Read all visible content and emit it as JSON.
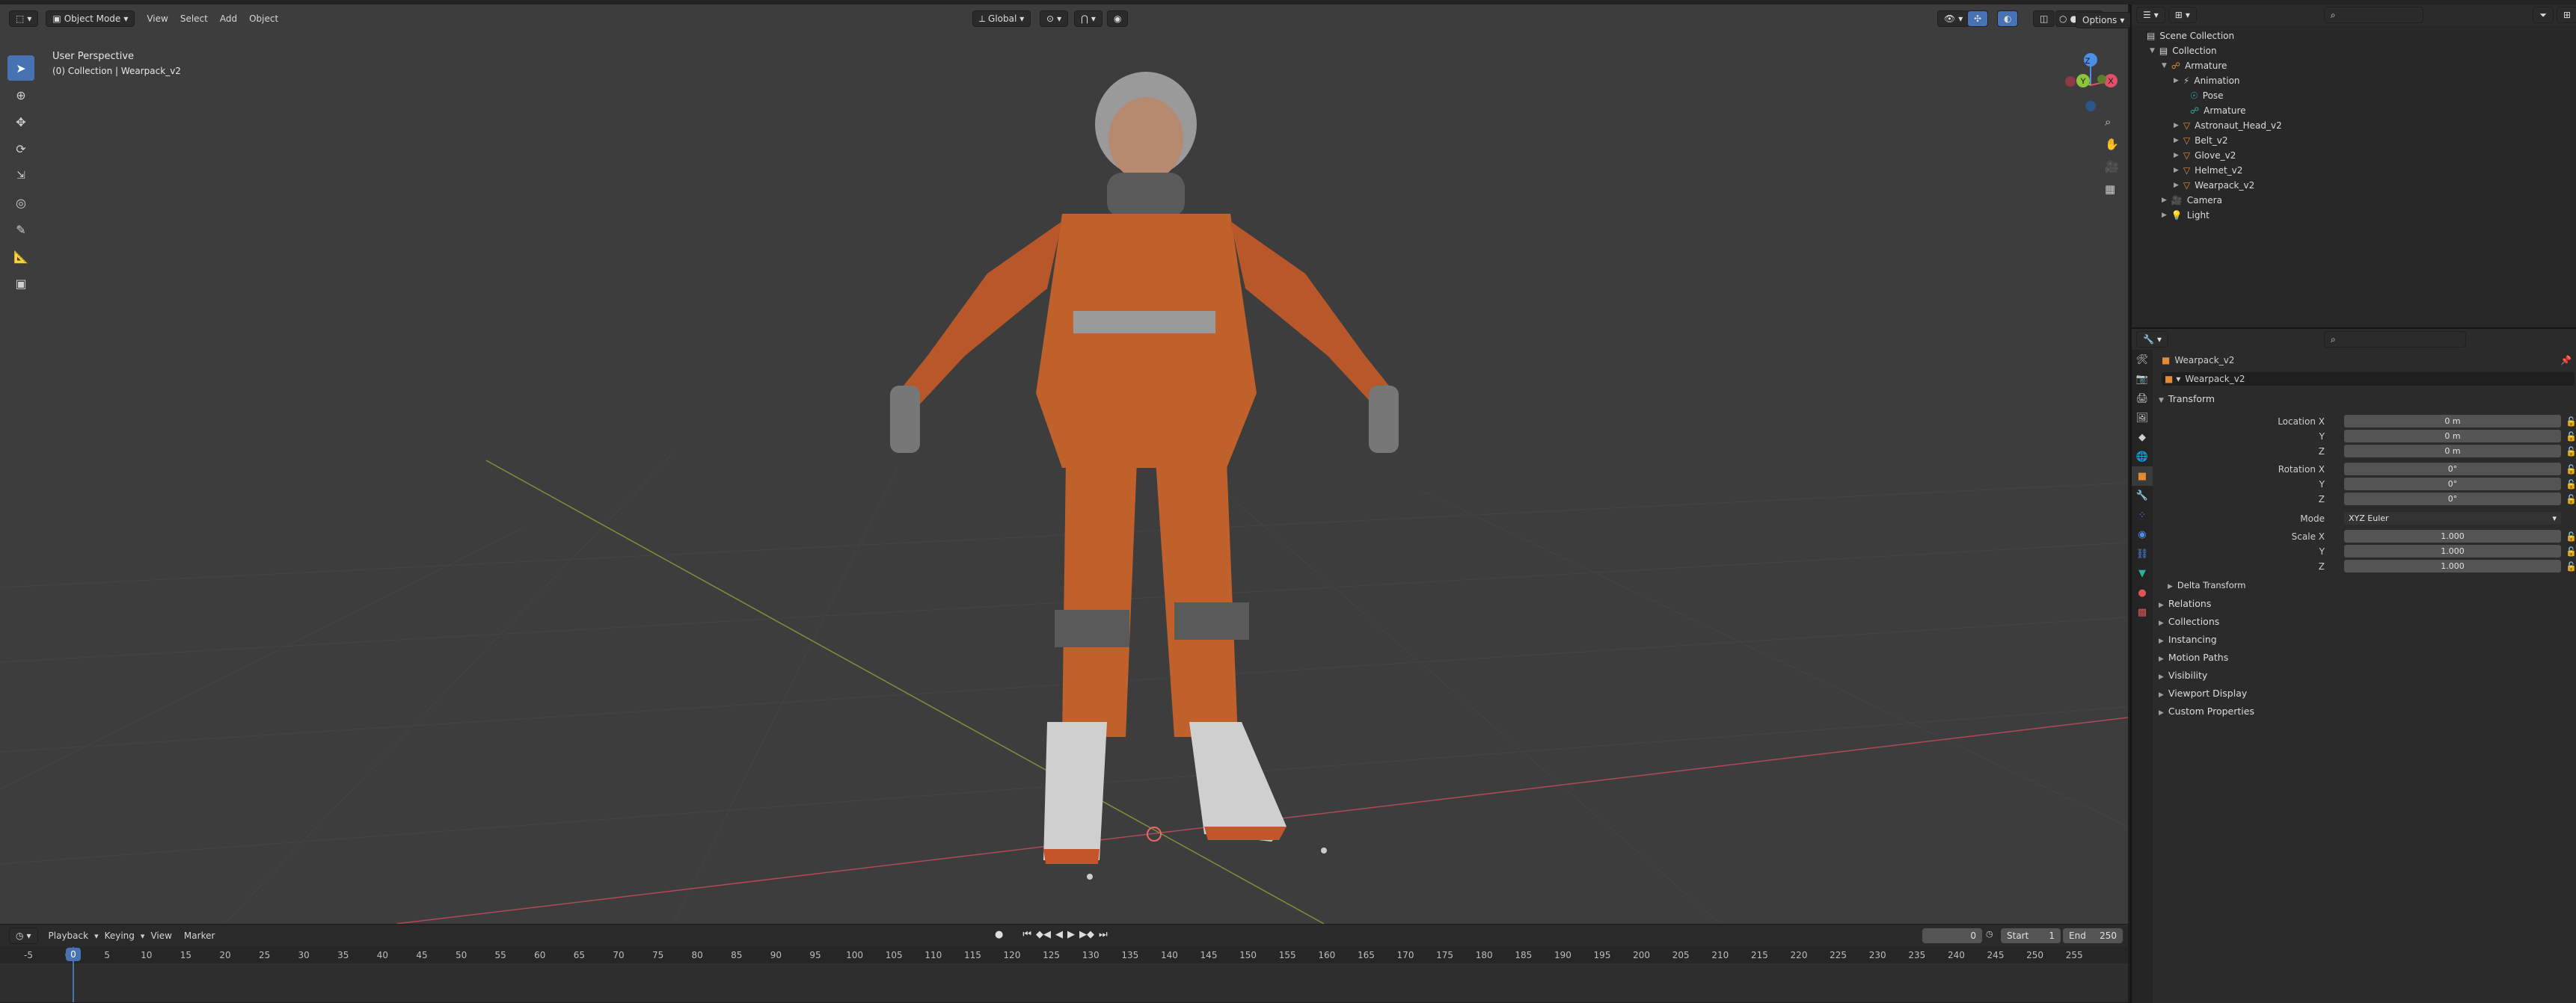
{
  "colors": {
    "accent": "#4772b3",
    "x_axis": "#e0506a",
    "y_axis": "#8cc43a",
    "z_axis": "#4d8ee8",
    "orange": "#e38a3a",
    "teal": "#28b5a0"
  },
  "viewport": {
    "mode_label": "Object Mode",
    "menu": [
      "View",
      "Select",
      "Add",
      "Object"
    ],
    "transform_orientation": "Global",
    "options_label": "Options",
    "overlay_title": "User Perspective",
    "overlay_subtitle": "(0) Collection | Wearpack_v2",
    "gizmo": {
      "x": "X",
      "y": "Y",
      "z": "Z"
    }
  },
  "timeline": {
    "menu": [
      "Playback",
      "Keying",
      "View",
      "Marker"
    ],
    "current_frame": "0",
    "start_label": "Start",
    "start_value": "1",
    "end_label": "End",
    "end_value": "250",
    "playhead": "0",
    "ruler": [
      "-5",
      "0",
      "5",
      "10",
      "15",
      "20",
      "25",
      "30",
      "35",
      "40",
      "45",
      "50",
      "55",
      "60",
      "65",
      "70",
      "75",
      "80",
      "85",
      "90",
      "95",
      "100",
      "105",
      "110",
      "115",
      "120",
      "125",
      "130",
      "135",
      "140",
      "145",
      "150",
      "155",
      "160",
      "165",
      "170",
      "175",
      "180",
      "185",
      "190",
      "195",
      "200",
      "205",
      "210",
      "215",
      "220",
      "225",
      "230",
      "235",
      "240",
      "245",
      "250",
      "255"
    ]
  },
  "outliner": {
    "root": "Scene Collection",
    "items": [
      {
        "label": "Collection",
        "icon": "collection-icon"
      },
      {
        "label": "Armature",
        "icon": "armature-icon"
      },
      {
        "label": "Animation",
        "icon": "action-icon"
      },
      {
        "label": "Pose",
        "icon": "pose-icon"
      },
      {
        "label": "Armature",
        "icon": "armature-data-icon"
      },
      {
        "label": "Astronaut_Head_v2",
        "icon": "mesh-icon"
      },
      {
        "label": "Belt_v2",
        "icon": "mesh-icon"
      },
      {
        "label": "Glove_v2",
        "icon": "mesh-icon"
      },
      {
        "label": "Helmet_v2",
        "icon": "mesh-icon"
      },
      {
        "label": "Wearpack_v2",
        "icon": "mesh-icon"
      },
      {
        "label": "Camera",
        "icon": "camera-icon"
      },
      {
        "label": "Light",
        "icon": "light-icon"
      }
    ]
  },
  "properties": {
    "object_name_header": "Wearpack_v2",
    "object_name_field": "Wearpack_v2",
    "transform_label": "Transform",
    "location": {
      "label": "Location X",
      "x": "0 m",
      "y_label": "Y",
      "y": "0 m",
      "z_label": "Z",
      "z": "0 m"
    },
    "rotation": {
      "label": "Rotation X",
      "x": "0°",
      "y_label": "Y",
      "y": "0°",
      "z_label": "Z",
      "z": "0°"
    },
    "mode": {
      "label": "Mode",
      "value": "XYZ Euler"
    },
    "scale": {
      "label": "Scale X",
      "x": "1.000",
      "y_label": "Y",
      "y": "1.000",
      "z_label": "Z",
      "z": "1.000"
    },
    "delta_transform": "Delta Transform",
    "sections": [
      "Relations",
      "Collections",
      "Instancing",
      "Motion Paths",
      "Visibility",
      "Viewport Display",
      "Custom Properties"
    ]
  }
}
